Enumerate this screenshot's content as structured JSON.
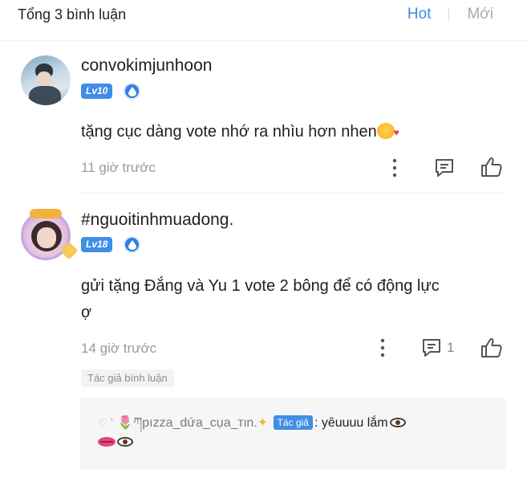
{
  "header": {
    "total_label": "Tổng 3 bình luận",
    "sort_hot": "Hot",
    "sort_new": "Mới"
  },
  "comments": [
    {
      "username": "convokimjunhoon",
      "level": "Lv10",
      "text": "tặng cục dàng vote nhớ ra nhìu hơn nhen",
      "time": "11 giờ trước",
      "reply_count": ""
    },
    {
      "username": "#nguoitinhmuadong.",
      "level": "Lv18",
      "text_line1": "gửi tặng Đắng và Yu 1 vote 2 bông để có động lực",
      "text_line2": "ợ",
      "time": "14 giờ trước",
      "reply_count": "1",
      "author_chip": "Tác giả bình luận",
      "reply": {
        "prefix_deco": "♡ ˚",
        "author_name": "ཀpızza_dứa_cụa_тιn.",
        "author_tag": "Tác giả",
        "text": ": yêuuuu lắm"
      }
    }
  ],
  "colors": {
    "accent": "#3a8ee6",
    "muted": "#9a9a9a",
    "level_badge": "#3e8ee6"
  },
  "icons": [
    "more-vertical-icon",
    "comment-icon",
    "thumbs-up-icon",
    "water-drop-icon"
  ]
}
